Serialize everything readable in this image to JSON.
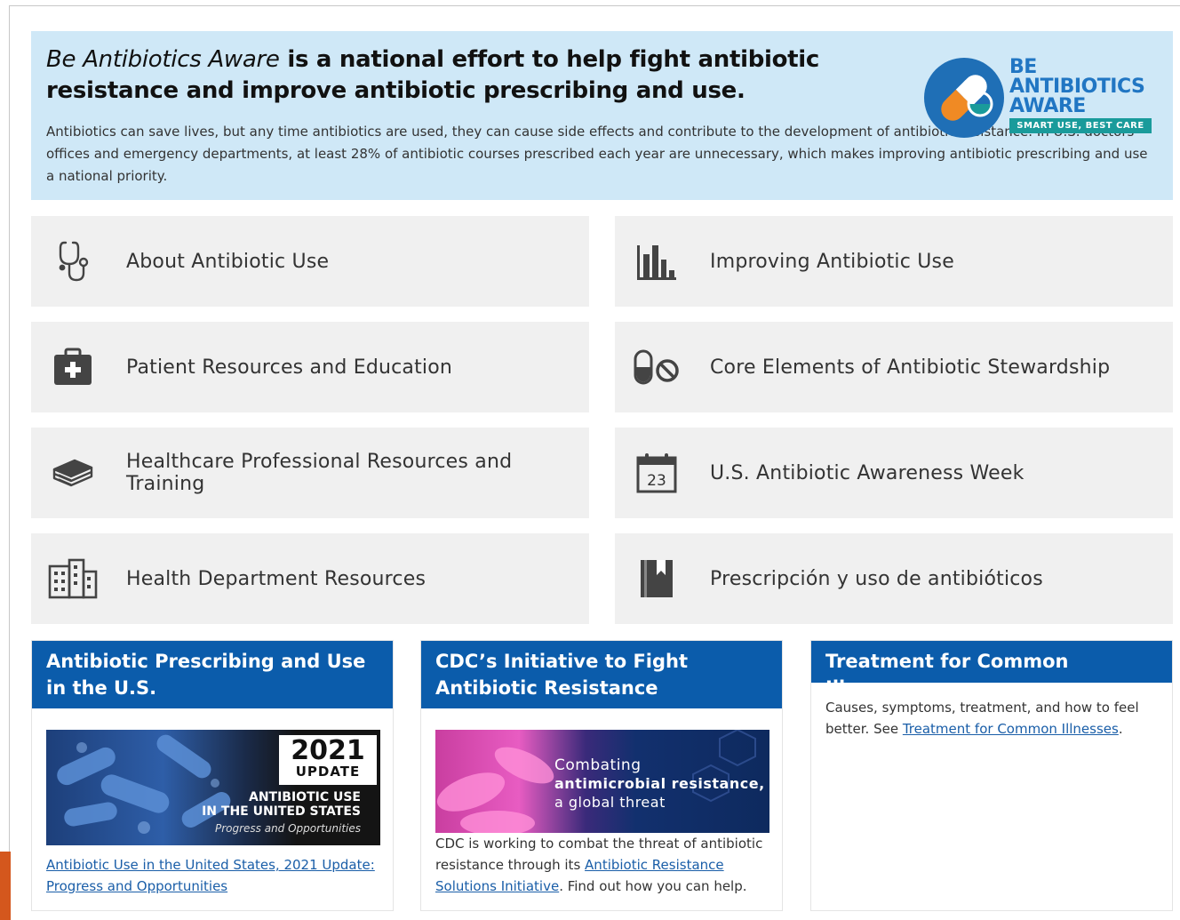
{
  "banner": {
    "title_italic": "Be Antibiotics Aware",
    "title_rest": "is a national effort to help fight antibiotic resistance and improve antibiotic prescribing and use.",
    "body": "Antibiotics can save lives, but any time antibiotics are used, they can cause side effects and contribute to the development of antibiotic resistance. In U.S. doctors’ offices and emergency departments, at least 28% of antibiotic courses prescribed each year are unnecessary, which makes improving antibiotic prescribing and use a national priority.",
    "logo": {
      "line1": "BE",
      "line2": "ANTIBIOTICS",
      "line3": "AWARE",
      "tagline": "SMART USE, BEST CARE",
      "colors": {
        "blue": "#1f6fb6",
        "teal": "#1a9b9b",
        "orange": "#f08a24"
      }
    }
  },
  "tiles": [
    {
      "icon": "stethoscope-icon",
      "label": "About Antibiotic Use"
    },
    {
      "icon": "bar-chart-icon",
      "label": "Improving Antibiotic Use"
    },
    {
      "icon": "medical-kit-icon",
      "label": "Patient Resources and Education"
    },
    {
      "icon": "no-pill-icon",
      "label": "Core Elements of Antibiotic Stewardship"
    },
    {
      "icon": "books-icon",
      "label": "Healthcare Professional Resources and Training"
    },
    {
      "icon": "calendar-icon",
      "label": "U.S. Antibiotic Awareness Week",
      "calendar_day": "23"
    },
    {
      "icon": "buildings-icon",
      "label": "Health Department Resources"
    },
    {
      "icon": "bookmark-book-icon",
      "label": "Prescripción y uso de antibióticos"
    }
  ],
  "cards": [
    {
      "title": "Antibiotic Prescribing and Use in the U.S.",
      "image": {
        "year": "2021",
        "update": "UPDATE",
        "line1": "ANTIBIOTIC USE",
        "line2": "IN THE UNITED STATES",
        "line3": "Progress and Opportunities"
      },
      "link": "Antibiotic Use in the United States, 2021 Update: Progress and Opportunities"
    },
    {
      "title": "CDC’s Initiative to Fight Antibiotic Resistance",
      "image": {
        "line1": "Combating",
        "line2": "antimicrobial resistance,",
        "line3": "a global threat"
      },
      "text_before": "CDC is working to combat the threat of antibiotic resistance through its",
      "link": "Antibiotic Resistance Solutions Initiative",
      "text_after": ". Find out how you can help."
    },
    {
      "title": "Treatment for Common Illnesses",
      "text_before": "Causes, symptoms, treatment, and how to feel better. See",
      "link": "Treatment for Common Illnesses",
      "text_after": "."
    }
  ]
}
